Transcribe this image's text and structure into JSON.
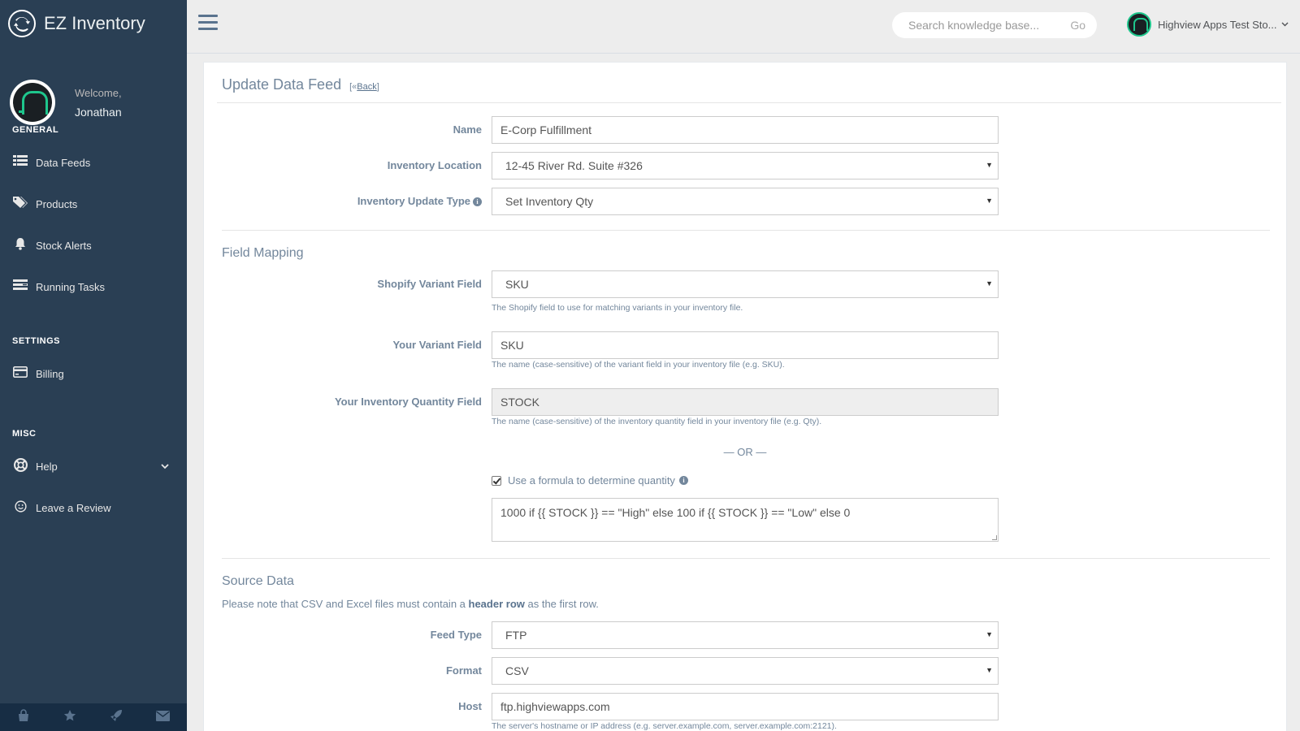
{
  "app": {
    "name": "EZ Inventory",
    "logo_icon": "sync-icon"
  },
  "profile": {
    "welcome": "Welcome,",
    "name": "Jonathan"
  },
  "sidebar": {
    "sections": [
      {
        "title": "GENERAL",
        "items": [
          {
            "label": "Data Feeds",
            "icon": "list-icon"
          },
          {
            "label": "Products",
            "icon": "tags-icon"
          },
          {
            "label": "Stock Alerts",
            "icon": "bell-icon"
          },
          {
            "label": "Running Tasks",
            "icon": "tasks-icon"
          }
        ]
      },
      {
        "title": "SETTINGS",
        "items": [
          {
            "label": "Billing",
            "icon": "credit-card-icon"
          }
        ]
      },
      {
        "title": "MISC",
        "items": [
          {
            "label": "Help",
            "icon": "life-ring-icon"
          },
          {
            "label": "Leave a Review",
            "icon": "smile-icon"
          }
        ]
      }
    ],
    "footer_icons": [
      "shopping-bag-icon",
      "star-icon",
      "rocket-icon",
      "envelope-icon"
    ]
  },
  "topnav": {
    "search_placeholder": "Search knowledge base...",
    "search_go": "Go",
    "store_name": "Highview Apps Test Sto..."
  },
  "page": {
    "title": "Update Data Feed",
    "back_prefix": "[«",
    "back_link": "Back",
    "back_suffix": "]"
  },
  "form": {
    "name_label": "Name",
    "name_value": "E-Corp Fulfillment",
    "location_label": "Inventory Location",
    "location_value": "12-45 River Rd. Suite #326",
    "update_type_label": "Inventory Update Type",
    "update_type_value": "Set Inventory Qty",
    "field_mapping_heading": "Field Mapping",
    "shopify_variant_label": "Shopify Variant Field",
    "shopify_variant_value": "SKU",
    "shopify_variant_help": "The Shopify field to use for matching variants in your inventory file.",
    "your_variant_label": "Your Variant Field",
    "your_variant_value": "SKU",
    "your_variant_help": "The name (case-sensitive) of the variant field in your inventory file (e.g. SKU).",
    "qty_field_label": "Your Inventory Quantity Field",
    "qty_field_value": "STOCK",
    "qty_field_help": "The name (case-sensitive) of the inventory quantity field in your inventory file (e.g. Qty).",
    "or_text": "— OR —",
    "formula_checkbox_label": "Use a formula to determine quantity",
    "formula_checked": true,
    "formula_value": "1000 if {{ STOCK }} == \"High\" else 100 if {{ STOCK }} == \"Low\" else 0",
    "source_heading": "Source Data",
    "source_note_before": "Please note that CSV and Excel files must contain a ",
    "source_note_bold": "header row",
    "source_note_after": " as the first row.",
    "feed_type_label": "Feed Type",
    "feed_type_value": "FTP",
    "format_label": "Format",
    "format_value": "CSV",
    "host_label": "Host",
    "host_value": "ftp.highviewapps.com",
    "host_help": "The server's hostname or IP address (e.g. server.example.com, server.example.com:2121)."
  }
}
